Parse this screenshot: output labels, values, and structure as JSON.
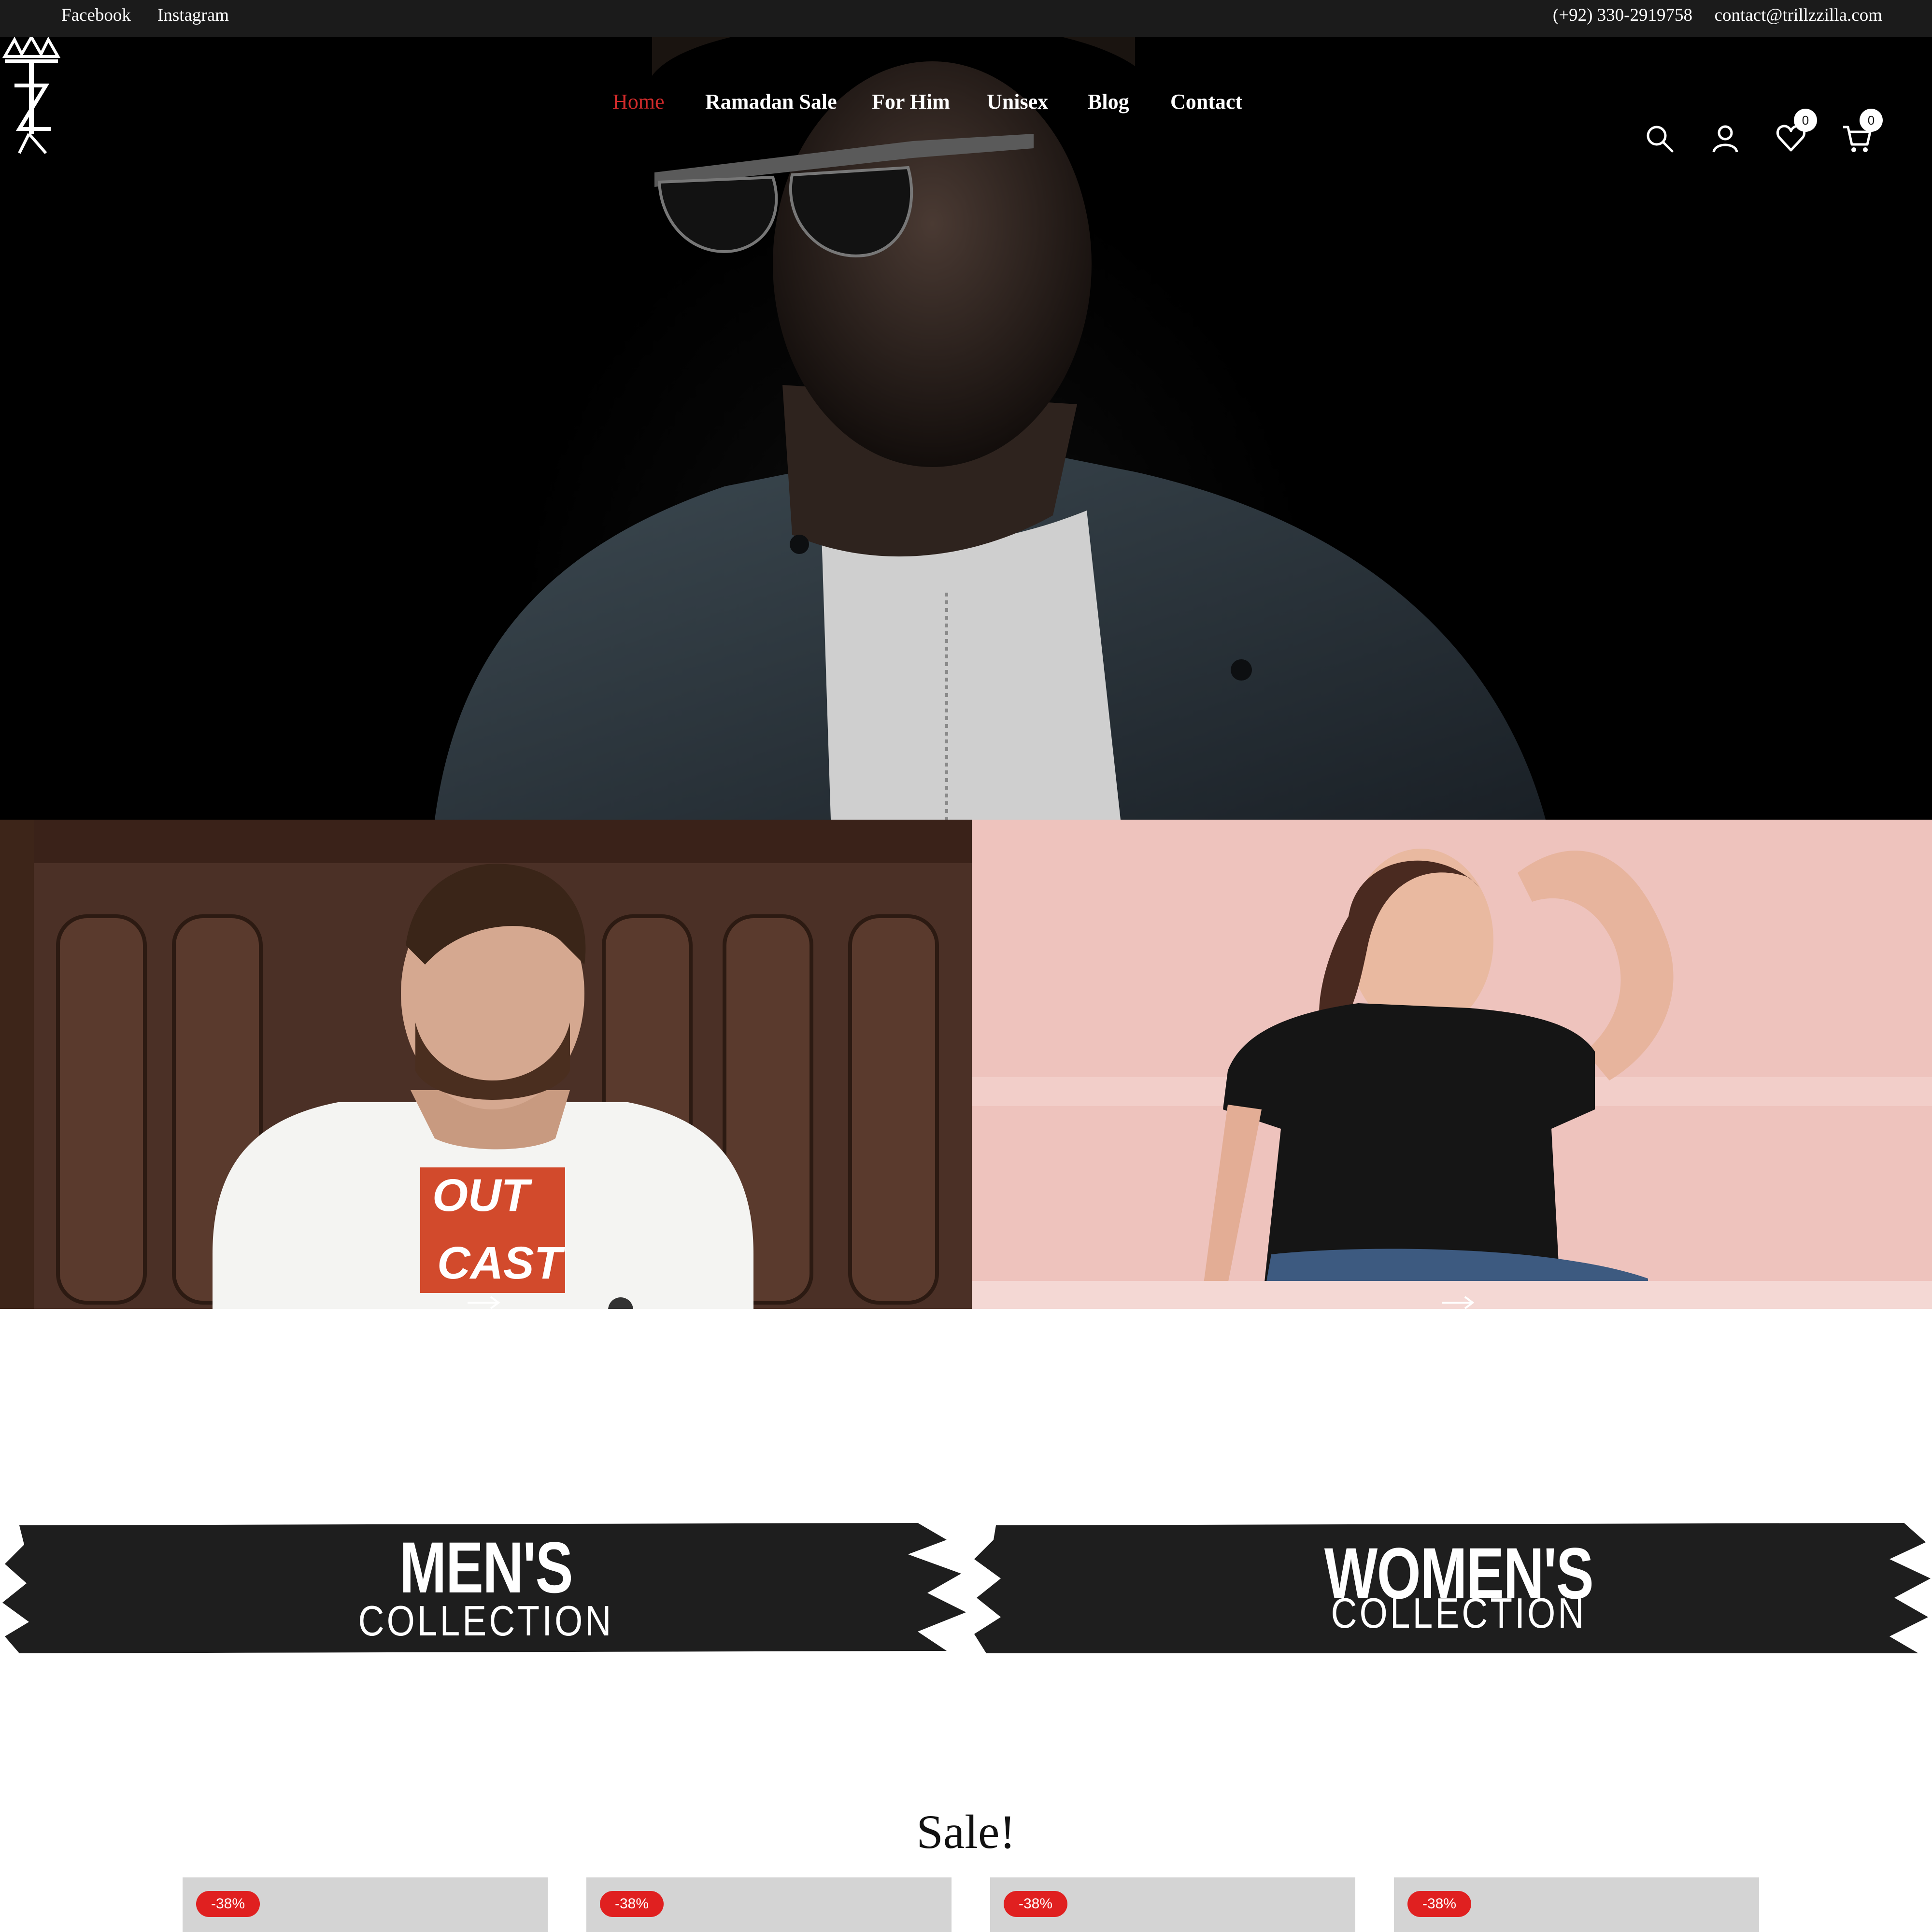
{
  "topbar": {
    "facebook": "Facebook",
    "instagram": "Instagram",
    "phone": "(+92) 330-2919758",
    "email": "contact@trillzzilla.com"
  },
  "nav": {
    "items": [
      "Home",
      "Ramadan Sale",
      "For Him",
      "Unisex",
      "Blog",
      "Contact"
    ],
    "active": "Home",
    "active_color": "#d22b2b"
  },
  "header_icons": {
    "search": "search-icon",
    "account": "user-icon",
    "wishlist": "heart-icon",
    "cart": "cart-icon",
    "wishlist_count": "0",
    "cart_count": "0"
  },
  "collections": {
    "men": {
      "title": "MEN'S",
      "subtitle": "COLLECTION",
      "arrow": "→"
    },
    "women": {
      "title": "WOMEN'S",
      "subtitle": "COLLECTION",
      "arrow": "→"
    }
  },
  "sale": {
    "heading": "Sale!",
    "cards": [
      {
        "badge": "-38%"
      },
      {
        "badge": "-38%"
      },
      {
        "badge": "-38%"
      },
      {
        "badge": "-38%"
      }
    ],
    "badge_color": "#e02020"
  }
}
